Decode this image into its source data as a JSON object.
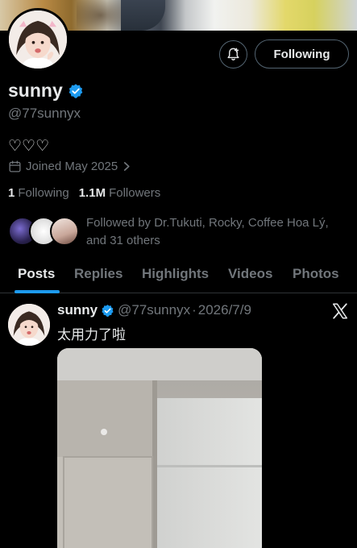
{
  "profile": {
    "display_name": "sunny",
    "handle": "@77sunnyx",
    "bio": "♡♡♡",
    "joined": "Joined May 2025",
    "following_count": "1",
    "following_label": "Following",
    "followers_count": "1.1M",
    "followers_label": "Followers",
    "followed_by": "Followed by Dr.Tukuti, Rocky, Coffee Hoa Lý, and 31 others"
  },
  "actions": {
    "following_button": "Following",
    "notify_icon": "bell-plus-icon"
  },
  "tabs": [
    {
      "label": "Posts",
      "active": true
    },
    {
      "label": "Replies",
      "active": false
    },
    {
      "label": "Highlights",
      "active": false
    },
    {
      "label": "Videos",
      "active": false
    },
    {
      "label": "Photos",
      "active": false
    }
  ],
  "post": {
    "author": "sunny",
    "handle": "@77sunnyx",
    "separator": "·",
    "date": "2026/7/9",
    "text": "太用力了啦",
    "source_icon": "x-logo-icon"
  },
  "colors": {
    "background": "#000000",
    "accent": "#1d9bf0",
    "text_primary": "#e7e9ea",
    "text_secondary": "#71767b",
    "border": "#536471"
  }
}
